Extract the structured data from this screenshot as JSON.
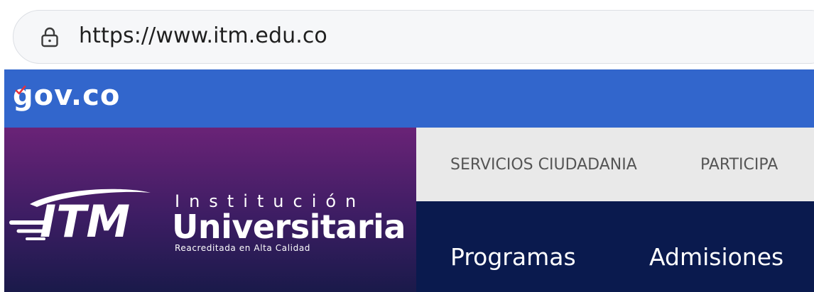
{
  "browser": {
    "url": "https://www.itm.edu.co",
    "lock_icon": "lock-icon"
  },
  "gov_bar": {
    "logo_text": "gov.co",
    "color": "#3266cc"
  },
  "brand": {
    "logo_text": "ITM",
    "institution_small": "Institución",
    "institution_big": "Universitaria",
    "tagline": "Reacreditada en Alta Calidad",
    "gradient_top": "#6a2377",
    "gradient_bottom": "#1a1a4a"
  },
  "top_links": [
    {
      "label": "SERVICIOS CIUDADANIA"
    },
    {
      "label": "PARTICIPA"
    }
  ],
  "main_nav": [
    {
      "label": "Programas"
    },
    {
      "label": "Admisiones"
    }
  ]
}
